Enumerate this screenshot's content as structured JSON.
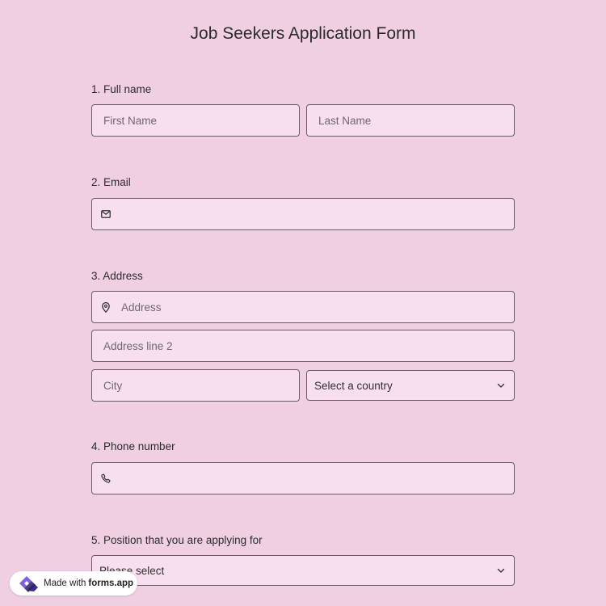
{
  "form": {
    "title": "Job Seekers Application Form",
    "questions": [
      {
        "label": "1.  Full name"
      },
      {
        "label": "2. Email"
      },
      {
        "label": "3. Address"
      },
      {
        "label": "4. Phone number"
      },
      {
        "label": "5. Position that you are applying for"
      }
    ],
    "full_name": {
      "first_placeholder": "First Name",
      "last_placeholder": "Last Name"
    },
    "email": {
      "placeholder": "",
      "icon": "envelope-icon"
    },
    "address": {
      "line1_placeholder": "Address",
      "line2_placeholder": "Address line 2",
      "city_placeholder": "City",
      "country_select": "Select a country",
      "icon": "map-pin-icon"
    },
    "phone": {
      "placeholder": "",
      "icon": "phone-icon"
    },
    "position": {
      "select": "Please select"
    }
  },
  "badge": {
    "prefix": "Made with",
    "brand": "forms.app"
  },
  "colors": {
    "background": "#f0cfe3",
    "field": "#f8dff0",
    "border": "#6a5c65"
  }
}
